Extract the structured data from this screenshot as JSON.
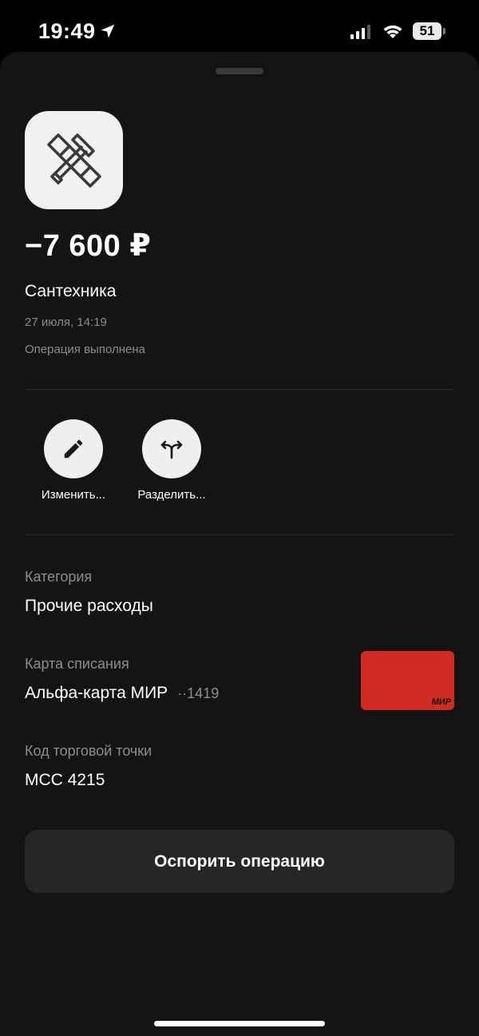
{
  "status_bar": {
    "time": "19:49",
    "battery": "51",
    "icons": [
      "location-arrow-icon",
      "signal-icon",
      "wifi-icon",
      "battery-icon"
    ]
  },
  "transaction": {
    "icon": "tools-icon",
    "amount": "−7 600 ₽",
    "merchant": "Сантехника",
    "date": "27 июля, 14:19",
    "status": "Операция выполнена"
  },
  "actions": [
    {
      "label": "Изменить...",
      "icon": "pencil-icon"
    },
    {
      "label": "Разделить...",
      "icon": "split-arrows-icon"
    }
  ],
  "details": {
    "category_label": "Категория",
    "category_value": "Прочие расходы",
    "card_label": "Карта списания",
    "card_name": "Альфа-карта МИР",
    "card_number": "··1419",
    "card_logo": "МИР",
    "card_color": "#d12a22",
    "mcc_label": "Код торговой точки",
    "mcc_value": "MCC 4215"
  },
  "dispute_button": "Оспорить операцию"
}
